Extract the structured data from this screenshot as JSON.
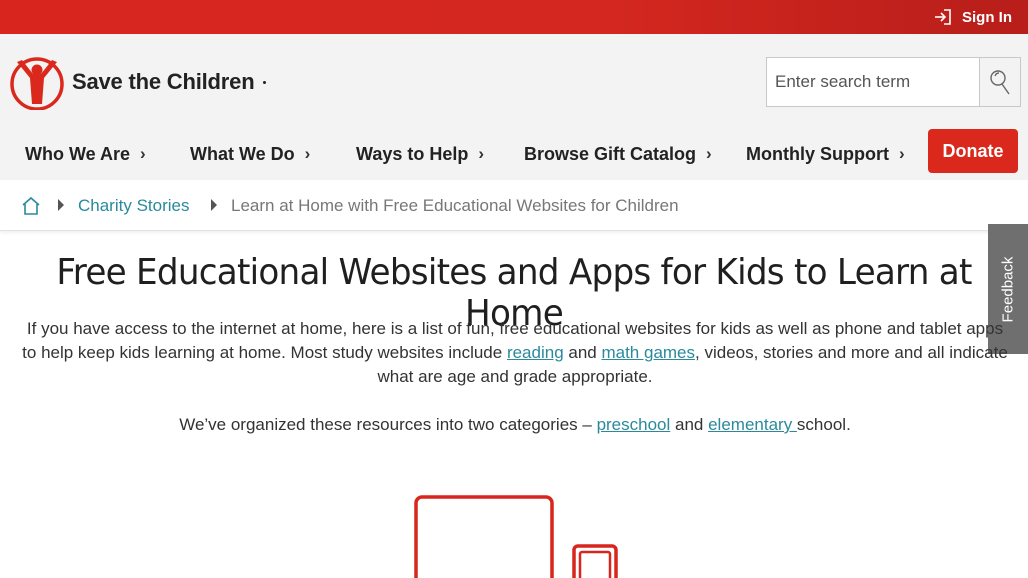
{
  "topbar": {
    "sign_in_label": "Sign In",
    "sign_in_icon": "sign-in-icon"
  },
  "header": {
    "logo_text": "Save the Children",
    "search_placeholder": "Enter search term",
    "search_icon": "search-icon"
  },
  "nav": {
    "items": [
      {
        "label": "Who We Are"
      },
      {
        "label": "What We Do"
      },
      {
        "label": "Ways to Help"
      },
      {
        "label": "Browse Gift Catalog"
      },
      {
        "label": "Monthly Support"
      }
    ],
    "chevron": "›",
    "donate_label": "Donate"
  },
  "breadcrumb": {
    "home_icon": "home-icon",
    "link_label": "Charity Stories",
    "current_label": "Learn at Home with Free Educational Websites for Children"
  },
  "feedback_label": "Feedback",
  "main": {
    "title": "Free Educational Websites and Apps for Kids to Learn at Home",
    "intro_part1": "If you have access to the internet at home, here is a list of fun, free educational websites for kids as well as phone and tablet apps to help keep kids learning at home. Most study websites include ",
    "intro_link1": "reading",
    "intro_part2": " and ",
    "intro_link2": "math games",
    "intro_part3": ", videos, stories and more and all indicate what are age and grade appropriate.",
    "categories_part1": "We’ve organized these resources into two categories – ",
    "categories_link1": "preschool",
    "categories_part2": " and ",
    "categories_link2": "elementary ",
    "categories_part3": "school."
  },
  "colors": {
    "brand_red": "#da291c",
    "link_teal": "#2a8a9c",
    "header_bg": "#f3f3f3"
  }
}
